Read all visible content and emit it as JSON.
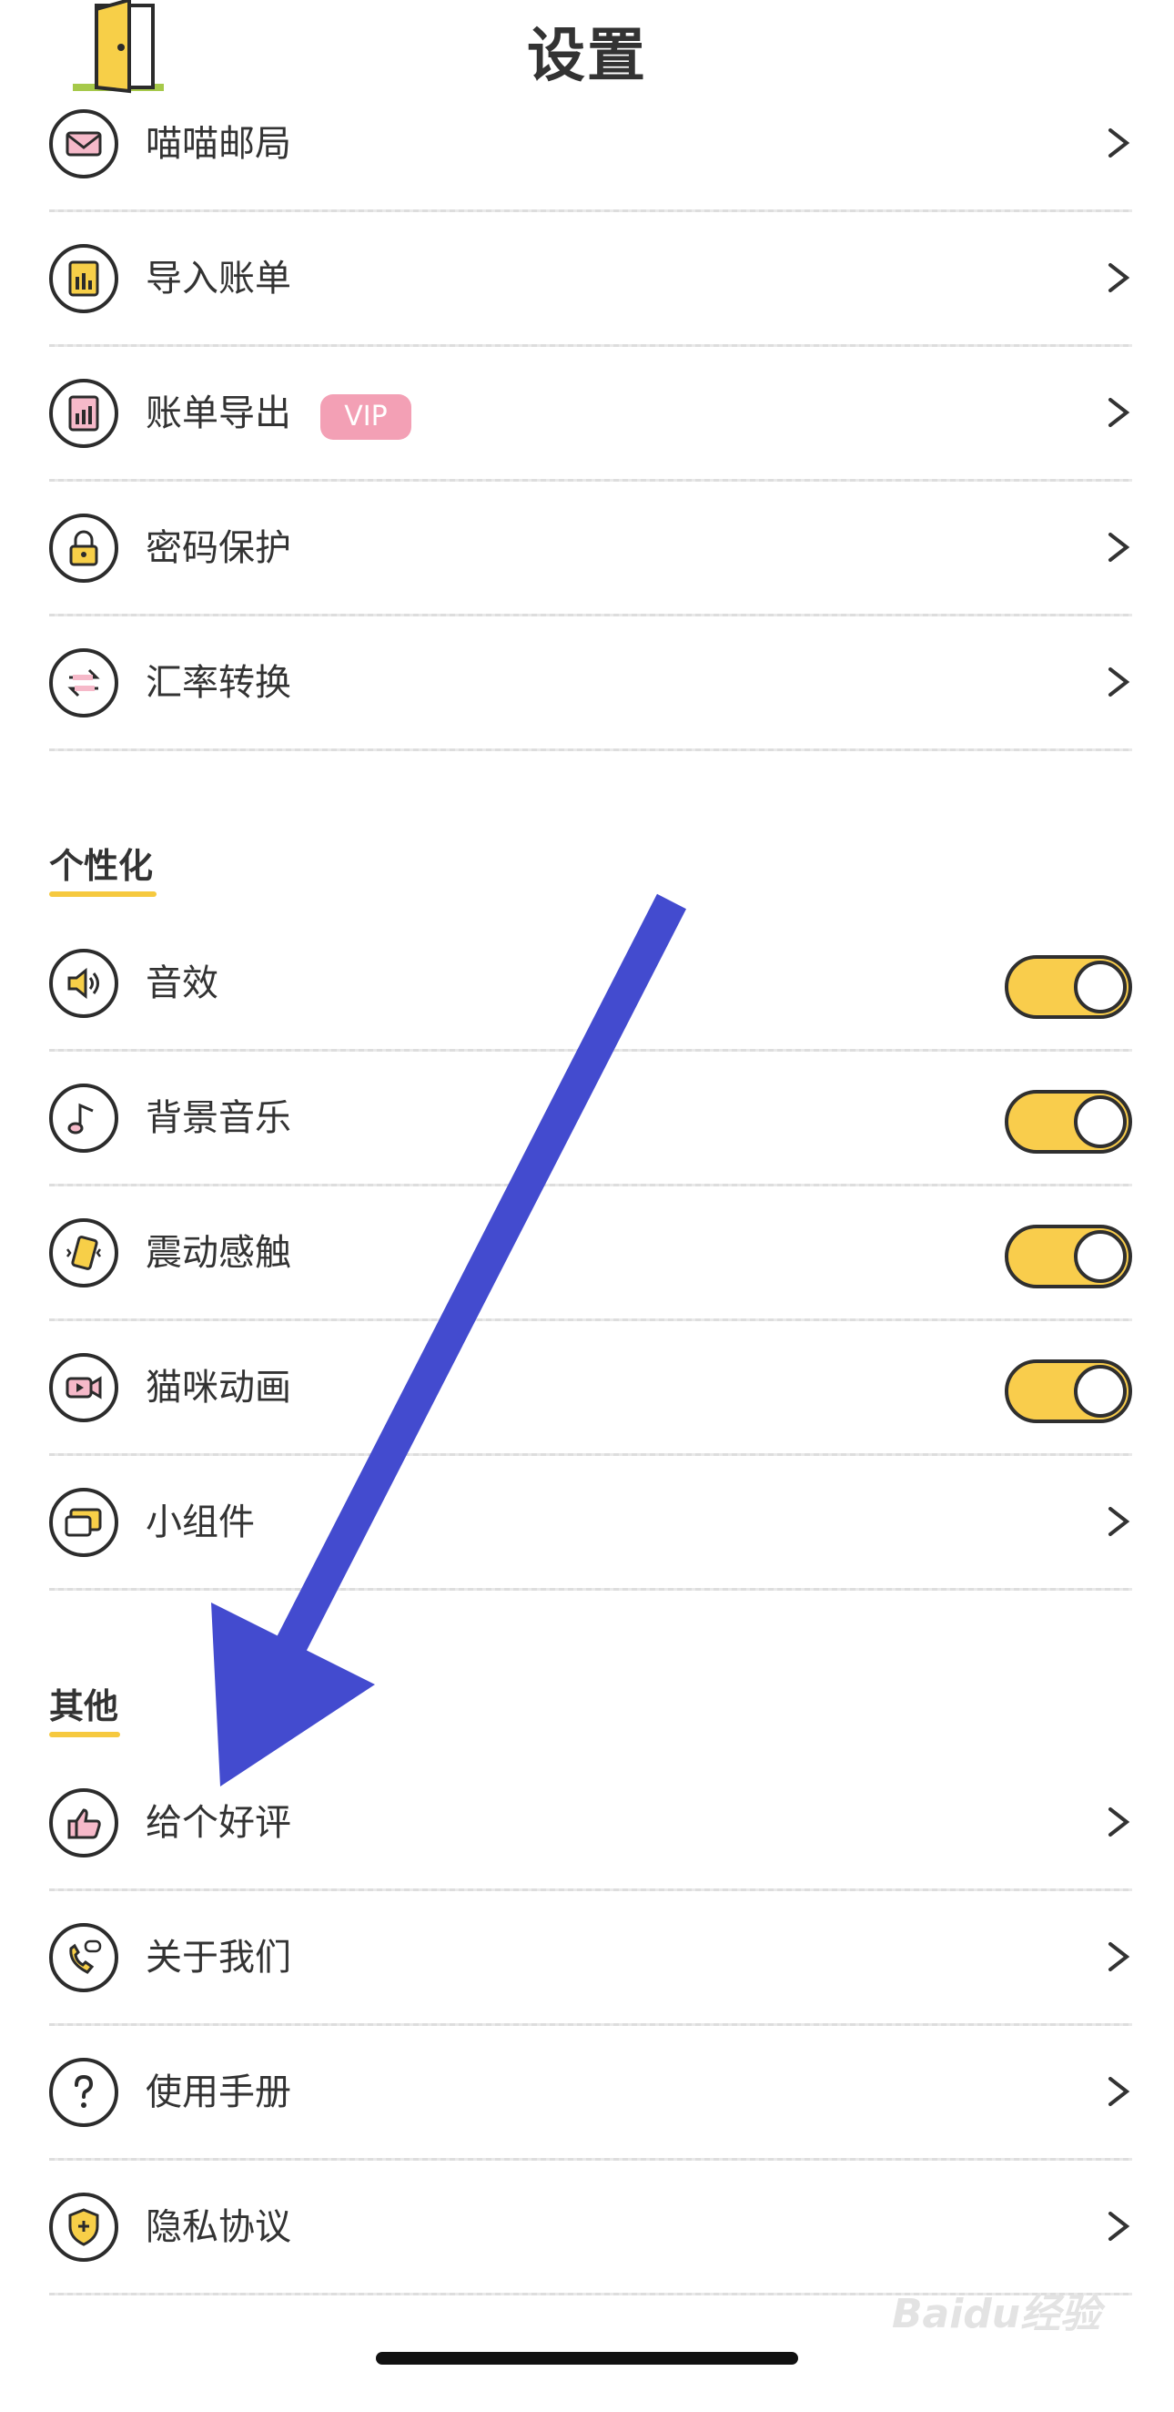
{
  "header": {
    "title": "设置"
  },
  "groups": {
    "top": [
      {
        "label": "喵喵邮局"
      },
      {
        "label": "导入账单"
      },
      {
        "label": "账单导出",
        "badge": "VIP"
      },
      {
        "label": "密码保护"
      },
      {
        "label": "汇率转换"
      }
    ],
    "personalization": {
      "title": "个性化",
      "items": [
        {
          "label": "音效",
          "toggle": true
        },
        {
          "label": "背景音乐",
          "toggle": true
        },
        {
          "label": "震动感触",
          "toggle": true
        },
        {
          "label": "猫咪动画",
          "toggle": true
        },
        {
          "label": "小组件"
        }
      ]
    },
    "other": {
      "title": "其他",
      "items": [
        {
          "label": "给个好评"
        },
        {
          "label": "关于我们"
        },
        {
          "label": "使用手册"
        },
        {
          "label": "隐私协议"
        }
      ]
    }
  },
  "colors": {
    "accent": "#f9cd4c",
    "vip": "#f3a0b5",
    "annotation_arrow": "#434bcf"
  },
  "watermark": "Baidu经验"
}
